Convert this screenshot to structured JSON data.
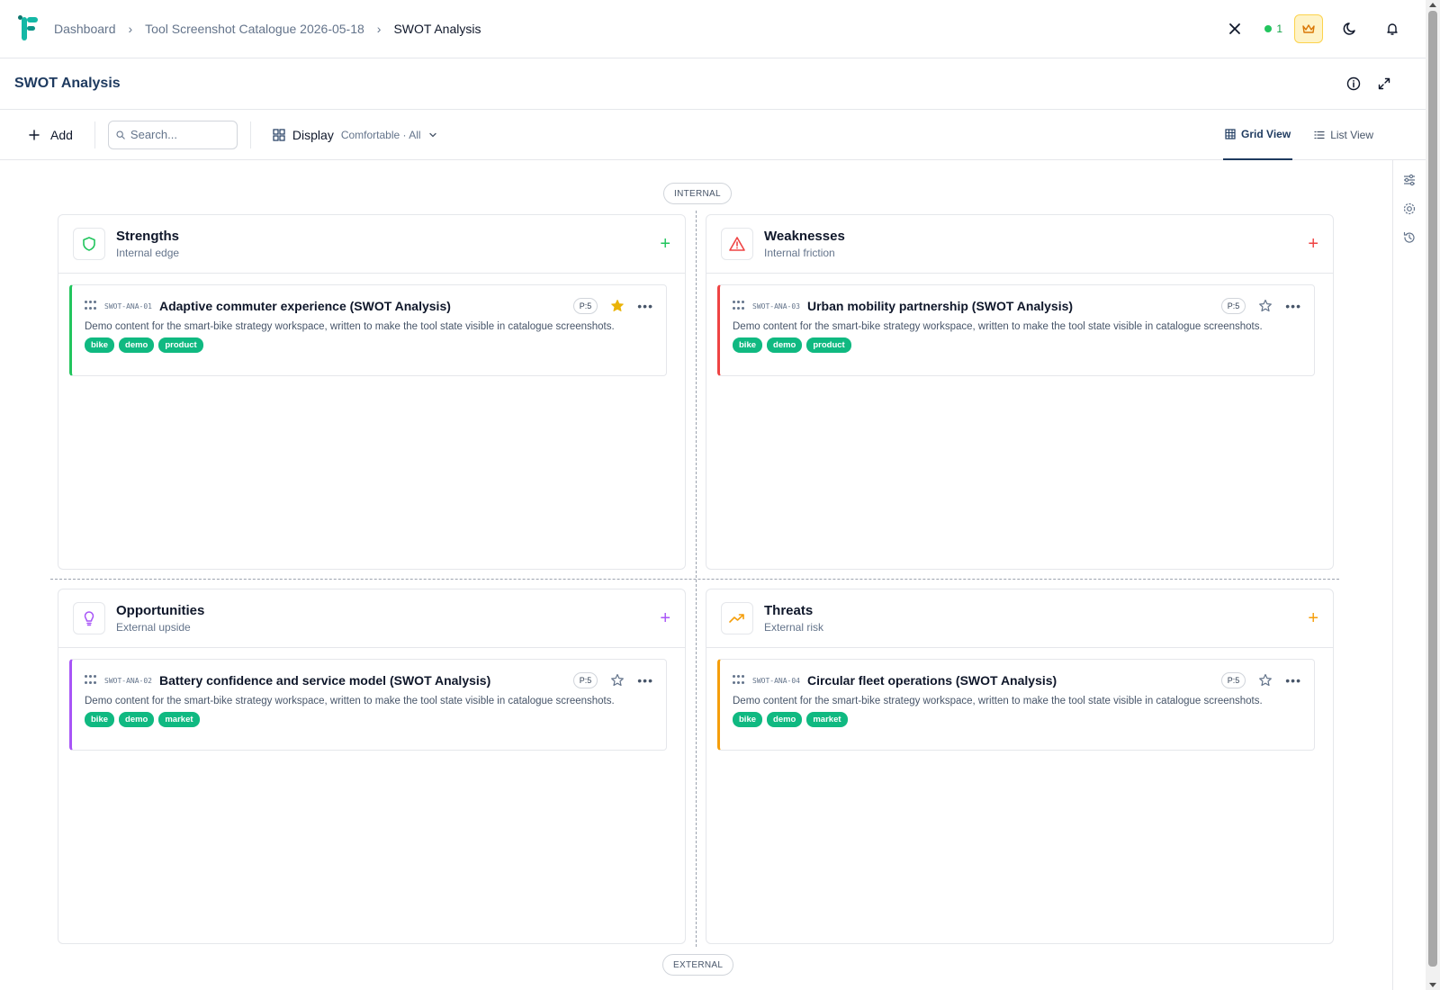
{
  "breadcrumb": [
    "Dashboard",
    "Tool Screenshot Catalogue 2026-05-18",
    "SWOT Analysis"
  ],
  "header": {
    "online_count": "1"
  },
  "page_title": "SWOT Analysis",
  "toolbar": {
    "add_label": "Add",
    "search_placeholder": "Search...",
    "display_label": "Display",
    "display_value": "Comfortable · All",
    "grid_view_label": "Grid View",
    "list_view_label": "List View"
  },
  "axis": {
    "top": "INTERNAL",
    "bottom": "EXTERNAL"
  },
  "quadrants": [
    {
      "title": "Strengths",
      "subtitle": "Internal edge",
      "color": "#22c55e",
      "icon": "shield-icon",
      "card": {
        "id": "SWOT-ANA-01",
        "title": "Adaptive commuter experience (SWOT Analysis)",
        "priority": "P:5",
        "starred": true,
        "description": "Demo content for the smart-bike strategy workspace, written to make the tool state visible in catalogue screenshots.",
        "tags": [
          "bike",
          "demo",
          "product"
        ]
      }
    },
    {
      "title": "Weaknesses",
      "subtitle": "Internal friction",
      "color": "#ef4444",
      "icon": "alert-triangle-icon",
      "card": {
        "id": "SWOT-ANA-03",
        "title": "Urban mobility partnership (SWOT Analysis)",
        "priority": "P:5",
        "starred": false,
        "description": "Demo content for the smart-bike strategy workspace, written to make the tool state visible in catalogue screenshots.",
        "tags": [
          "bike",
          "demo",
          "product"
        ]
      }
    },
    {
      "title": "Opportunities",
      "subtitle": "External upside",
      "color": "#a855f7",
      "icon": "lightbulb-icon",
      "card": {
        "id": "SWOT-ANA-02",
        "title": "Battery confidence and service model (SWOT Analysis)",
        "priority": "P:5",
        "starred": false,
        "description": "Demo content for the smart-bike strategy workspace, written to make the tool state visible in catalogue screenshots.",
        "tags": [
          "bike",
          "demo",
          "market"
        ]
      }
    },
    {
      "title": "Threats",
      "subtitle": "External risk",
      "color": "#f59e0b",
      "icon": "trending-up-icon",
      "card": {
        "id": "SWOT-ANA-04",
        "title": "Circular fleet operations (SWOT Analysis)",
        "priority": "P:5",
        "starred": false,
        "description": "Demo content for the smart-bike strategy workspace, written to make the tool state visible in catalogue screenshots.",
        "tags": [
          "bike",
          "demo",
          "market"
        ]
      }
    }
  ]
}
